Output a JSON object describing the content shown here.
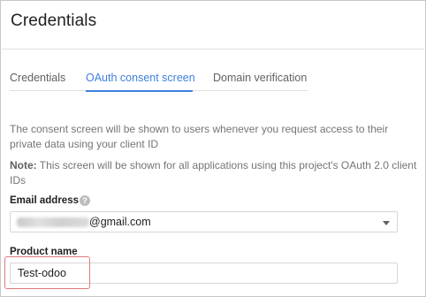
{
  "header": {
    "title": "Credentials"
  },
  "tabs": [
    {
      "label": "Credentials",
      "active": false
    },
    {
      "label": "OAuth consent screen",
      "active": true
    },
    {
      "label": "Domain verification",
      "active": false
    }
  ],
  "description": "The consent screen will be shown to users whenever you request access to their private data using your client ID",
  "note": {
    "prefix": "Note:",
    "text": " This screen will be shown for all applications using this project's OAuth 2.0 client IDs"
  },
  "email": {
    "label": "Email address",
    "help_icon": "?",
    "value_visible": "@gmail.com"
  },
  "product": {
    "label": "Product name",
    "value": "Test-odoo"
  },
  "colors": {
    "accent": "#3f7fdc",
    "highlight": "#e0797e"
  }
}
